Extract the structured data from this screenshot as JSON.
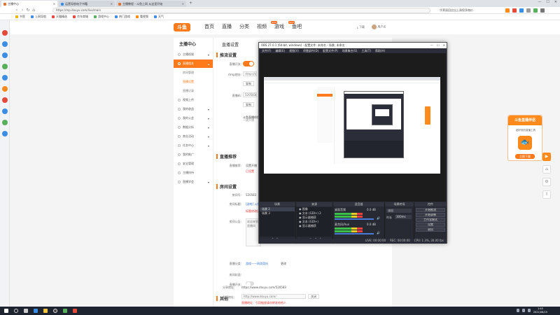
{
  "browser": {
    "tabs": [
      {
        "label": "主播中心",
        "active": true
      },
      {
        "label": "运营导航电子书籍"
      },
      {
        "label": "主播教程 - 斗鱼上网 从这里开始"
      }
    ],
    "url": "https://mp.douyu.com/live/main",
    "search_hint": "华莱丽回应出上周保多物价",
    "bookmarks": [
      "书签",
      "上网导航",
      "天猫精选",
      "京东商城",
      "游戏中心",
      "热门游戏",
      "看视频",
      "天气"
    ]
  },
  "site": {
    "logo": "斗鱼",
    "nav": [
      "首页",
      "直播",
      "分类",
      "视频",
      "游戏",
      "鱼吧"
    ],
    "nav_badges": [
      "NEW",
      "NEW"
    ],
    "header_right": [
      "下载",
      "用户名"
    ]
  },
  "left_menu": {
    "title": "主播中心",
    "items": [
      {
        "label": "主播权限"
      },
      {
        "label": "直播相关",
        "active": true
      },
      {
        "label": "房间管理",
        "sub": true
      },
      {
        "label": "直播设置",
        "sub": true,
        "current": true
      },
      {
        "label": "直播记录",
        "sub": true
      },
      {
        "label": "视频上传"
      },
      {
        "label": "我的收益"
      },
      {
        "label": "我的公会"
      },
      {
        "label": "数据分析"
      },
      {
        "label": "商业活动"
      },
      {
        "label": "任务中心"
      },
      {
        "label": "我的推广"
      },
      {
        "label": "安全管理"
      },
      {
        "label": "主播扶持"
      },
      {
        "label": "直播学会"
      }
    ]
  },
  "content": {
    "page_title": "直播设置",
    "sections": {
      "push": "推流设置",
      "recommend": "直播推荐",
      "room": "房间设置",
      "other": "其他"
    },
    "push_fields": {
      "switch_label": "直播开关:",
      "rtmp_label": "rtmp地址:",
      "rtmp_value": "rtmp://send",
      "copy1": "复制",
      "code_label": "直播码:",
      "code_value": "520583r",
      "copy2": "复制"
    },
    "notice": "斗鱼直播伴侣",
    "notice_sub": "一键开播",
    "recommend_fields": {
      "label": "直播推荐:",
      "value": "设置开播",
      "red": "已设置"
    },
    "room_fields": {
      "id_label": "房间号:",
      "id_value": "520583",
      "title_label": "房间标题:",
      "title_value": "[游戏] 斗鱼",
      "title_red": "标题修改后",
      "intro_label": "房间公告:",
      "intro_value": "欢迎来到直播间",
      "cat_label": "直播分类:",
      "cat_value": "游戏——网游竞技",
      "cat_change": "更改",
      "pic_label": "房间封面:",
      "toggle_label": "直播开关:"
    },
    "other_fields": {
      "share_label": "分享地址:",
      "share_value": "https://www.douyu.com/520583",
      "embed_label": "引用地址:",
      "embed_value": "http://www.douyu.com/",
      "embed_btn": "关闭",
      "red": "直播地址：引用链接请勿转发给他人"
    }
  },
  "obs": {
    "title": "OBS 27.0.1 (64-bit, windows) - 配置文件: 未命名 - 场景: 未命名",
    "menu": [
      "文件(F)",
      "编辑(E)",
      "视图(V)",
      "停靠部件(D)",
      "配置文件(P)",
      "场景集合(S)",
      "工具(T)",
      "帮助(H)"
    ],
    "docks": {
      "scenes": "场景",
      "sources": "来源",
      "mixer": "混音器",
      "transitions": "场景转场",
      "controls": "控件"
    },
    "scenes": [
      "场景 2",
      "场景 3"
    ],
    "sources": [
      "图像",
      "文本 (GDI+) 2",
      "显示器捕获",
      "文本 (GDI+)",
      "显示器捕获"
    ],
    "mixer": [
      "桌面音频",
      "麦克风/Aux"
    ],
    "mixer_db": [
      "0.0 dB",
      "0.0 dB"
    ],
    "transition": {
      "type": "淡出",
      "label": "时长",
      "value": "300ms"
    },
    "controls": [
      "开始推流",
      "开始录制",
      "工作室模式",
      "设置",
      "退出"
    ],
    "status": [
      "LIVE: 00:00:00",
      "REC: 00:00:00",
      "CPU: 1.3%, 30.00 fps"
    ]
  },
  "floater": {
    "title": "斗鱼直播伴侣",
    "sub": "超好用的直播工具",
    "button": "立即下载"
  },
  "taskbar": {
    "time": "1:45",
    "date": "2021/08/15"
  },
  "colors": {
    "accent": "#ff7a1a",
    "obs_bg": "#2b2e38",
    "taskbar": "#1f2530"
  }
}
